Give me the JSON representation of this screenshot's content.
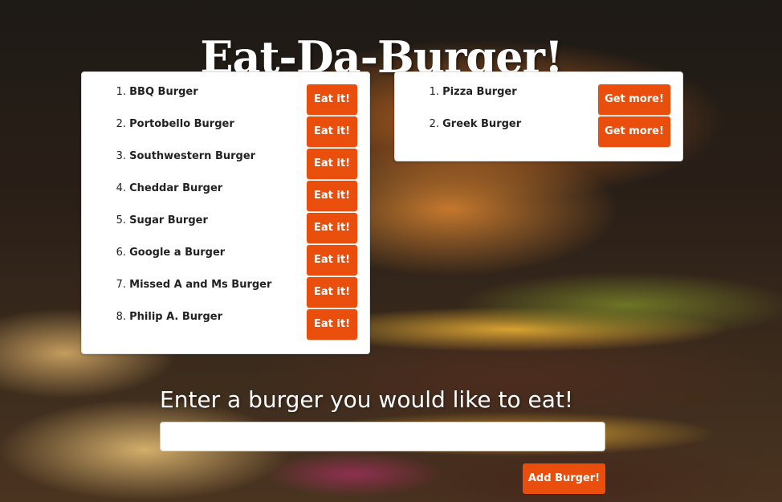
{
  "header": {
    "title": "Eat-Da-Burger!"
  },
  "uneaten": {
    "button_label": "Eat it!",
    "items": [
      {
        "num": "1.",
        "name": "BBQ Burger"
      },
      {
        "num": "2.",
        "name": "Portobello Burger"
      },
      {
        "num": "3.",
        "name": "Southwestern Burger"
      },
      {
        "num": "4.",
        "name": "Cheddar Burger"
      },
      {
        "num": "5.",
        "name": "Sugar Burger"
      },
      {
        "num": "6.",
        "name": "Google a Burger"
      },
      {
        "num": "7.",
        "name": "Missed A and Ms Burger"
      },
      {
        "num": "8.",
        "name": "Philip A. Burger"
      }
    ]
  },
  "eaten": {
    "button_label": "Get more!",
    "items": [
      {
        "num": "1.",
        "name": "Pizza Burger"
      },
      {
        "num": "2.",
        "name": "Greek Burger"
      }
    ]
  },
  "form": {
    "label": "Enter a burger you would like to eat!",
    "input_value": "",
    "submit_label": "Add Burger!"
  },
  "colors": {
    "accent": "#ea4e0c",
    "panel_bg": "#ffffff"
  }
}
